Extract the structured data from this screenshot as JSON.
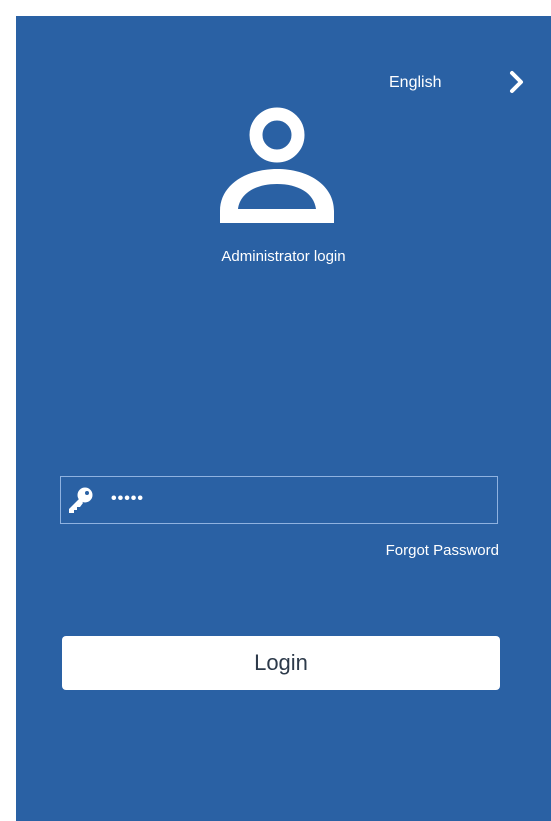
{
  "header": {
    "language": "English",
    "language_icon": "chevron-right-icon"
  },
  "hero": {
    "icon": "user-avatar-icon",
    "title": "Administrator login"
  },
  "form": {
    "password_icon": "key-icon",
    "password_value": "•••••",
    "forgot_password_label": "Forgot Password",
    "login_label": "Login"
  },
  "colors": {
    "background": "#2a61a4",
    "button_background": "#ffffff",
    "button_text": "#2d3a4a",
    "field_border": "#8fb2e0"
  }
}
